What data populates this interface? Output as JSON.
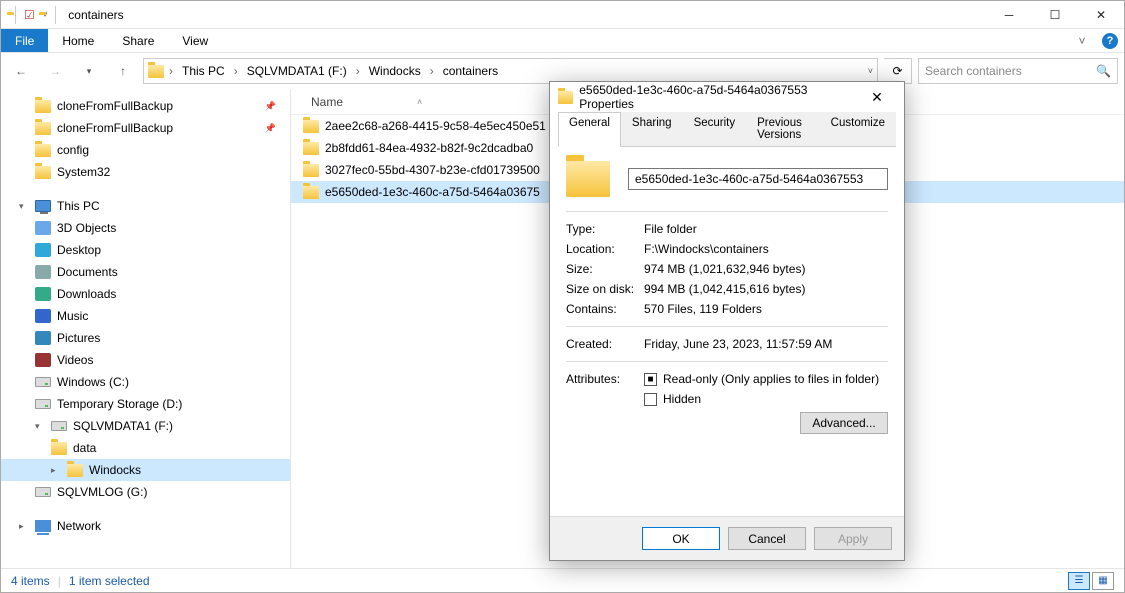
{
  "window": {
    "title": "containers"
  },
  "ribbon": {
    "file": "File",
    "home": "Home",
    "share": "Share",
    "view": "View"
  },
  "nav": {
    "crumbs": [
      "This PC",
      "SQLVMDATA1 (F:)",
      "Windocks",
      "containers"
    ]
  },
  "search": {
    "placeholder": "Search containers"
  },
  "tree": {
    "quick": [
      {
        "label": "cloneFromFullBackup",
        "pinned": true
      },
      {
        "label": "cloneFromFullBackup",
        "pinned": true
      },
      {
        "label": "config"
      },
      {
        "label": "System32"
      }
    ],
    "this_pc": "This PC",
    "pc_items": [
      "3D Objects",
      "Desktop",
      "Documents",
      "Downloads",
      "Music",
      "Pictures",
      "Videos"
    ],
    "drives": [
      "Windows (C:)",
      "Temporary Storage (D:)",
      "SQLVMDATA1 (F:)"
    ],
    "f_children": [
      "data",
      "Windocks"
    ],
    "drive_after": "SQLVMLOG (G:)",
    "network": "Network"
  },
  "list": {
    "header": "Name",
    "items": [
      "2aee2c68-a268-4415-9c58-4e5ec450e51",
      "2b8fdd61-84ea-4932-b82f-9c2dcadba0",
      "3027fec0-55bd-4307-b23e-cfd01739500",
      "e5650ded-1e3c-460c-a75d-5464a03675"
    ],
    "selected_index": 3
  },
  "status": {
    "count": "4 items",
    "selected": "1 item selected"
  },
  "dialog": {
    "title_suffix": "Properties",
    "folder_name": "e5650ded-1e3c-460c-a75d-5464a0367553",
    "tabs": [
      "General",
      "Sharing",
      "Security",
      "Previous Versions",
      "Customize"
    ],
    "type_label": "Type:",
    "type_value": "File folder",
    "location_label": "Location:",
    "location_value": "F:\\Windocks\\containers",
    "size_label": "Size:",
    "size_value": "974 MB (1,021,632,946 bytes)",
    "disk_label": "Size on disk:",
    "disk_value": "994 MB (1,042,415,616 bytes)",
    "contains_label": "Contains:",
    "contains_value": "570 Files, 119 Folders",
    "created_label": "Created:",
    "created_value": "Friday, June 23, 2023, 11:57:59 AM",
    "attributes_label": "Attributes:",
    "readonly_label": "Read-only (Only applies to files in folder)",
    "hidden_label": "Hidden",
    "advanced": "Advanced...",
    "ok": "OK",
    "cancel": "Cancel",
    "apply": "Apply"
  }
}
